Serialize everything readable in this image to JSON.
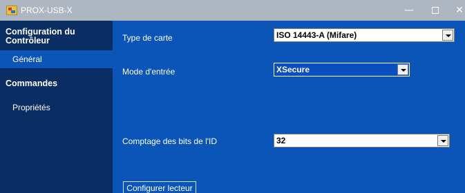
{
  "window": {
    "title": "PROX-USB-X",
    "icon": "app-icon",
    "controls": {
      "minimize": "—",
      "close": "✕"
    }
  },
  "sidebar": {
    "sections": [
      {
        "label": "Configuration du Contrôleur",
        "items": [
          {
            "label": "Général",
            "active": true
          }
        ]
      },
      {
        "label": "Commandes",
        "items": [
          {
            "label": "Propriétés",
            "active": false
          }
        ]
      }
    ]
  },
  "main": {
    "fields": [
      {
        "label": "Type de carte",
        "value": "ISO 14443-A (Mifare)"
      },
      {
        "label": "Mode d'entrée",
        "value": "XSecure"
      },
      {
        "label": "Comptage des bits de l'ID",
        "value": "32"
      }
    ],
    "configure_button": "Configurer lecteur"
  },
  "colors": {
    "panel_bg": "#0b55b8",
    "sidebar_bg": "#0a2e63",
    "titlebar_bg": "#aeb6c2"
  }
}
